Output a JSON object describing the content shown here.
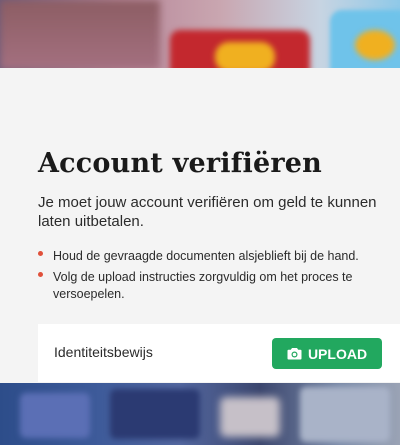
{
  "modal": {
    "title": "Account verifiëren",
    "description": "Je moet jouw account verifiëren om geld te kunnen laten uitbetalen.",
    "bullets": [
      "Houd de gevraagde documenten alsjeblieft bij de hand.",
      "Volg de upload instructies zorgvuldig om het proces te versoepelen."
    ],
    "documents": [
      {
        "label": "Identiteitsbewijs",
        "button_label": "UPLOAD",
        "button_icon": "camera-icon"
      }
    ]
  },
  "colors": {
    "panel_bg": "#f4f4f4",
    "button_bg": "#22a85f",
    "bullet_dot": "#e0503a",
    "text": "#2b2b2b",
    "title": "#1a1a1a"
  }
}
